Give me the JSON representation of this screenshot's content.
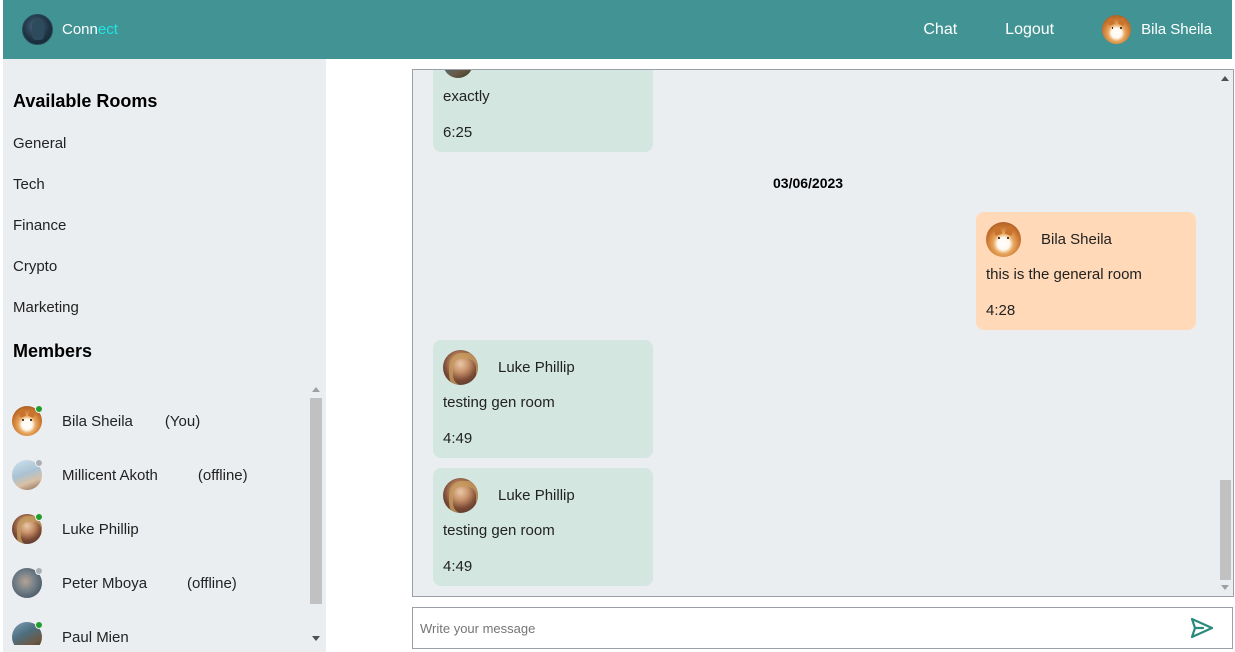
{
  "navbar": {
    "brand_prefix": "Conn",
    "brand_accent": "ect",
    "chat_label": "Chat",
    "logout_label": "Logout",
    "user_name": "Bila Sheila",
    "colors": {
      "background": "#429494",
      "accent": "#20e3e3"
    }
  },
  "sidebar": {
    "rooms_title": "Available Rooms",
    "rooms": [
      {
        "label": "General"
      },
      {
        "label": "Tech"
      },
      {
        "label": "Finance"
      },
      {
        "label": "Crypto"
      },
      {
        "label": "Marketing"
      }
    ],
    "members_title": "Members",
    "members": [
      {
        "name": "Bila Sheila",
        "tag": "(You)",
        "status": "online",
        "avatar": "shiba-avatar"
      },
      {
        "name": "Millicent Akoth",
        "tag": "(offline)",
        "status": "offline",
        "avatar": "beach-avatar"
      },
      {
        "name": "Luke Phillip",
        "tag": "",
        "status": "online",
        "avatar": "woman-avatar"
      },
      {
        "name": "Peter Mboya",
        "tag": "(offline)",
        "status": "offline",
        "avatar": "man-avatar"
      },
      {
        "name": "Paul Mien",
        "tag": "",
        "status": "online",
        "avatar": "hiker-avatar"
      }
    ]
  },
  "chat": {
    "messages": [
      {
        "id": "m0",
        "sender": "",
        "text": "exactly",
        "time": "6:25",
        "side": "received"
      },
      {
        "id": "m1",
        "sender": "Bila Sheila",
        "text": "this is the general room",
        "time": "4:28",
        "side": "sent"
      },
      {
        "id": "m2",
        "sender": "Luke Phillip",
        "text": "testing gen room",
        "time": "4:49",
        "side": "received"
      },
      {
        "id": "m3",
        "sender": "Luke Phillip",
        "text": "testing gen room",
        "time": "4:49",
        "side": "received"
      }
    ],
    "date_separator": "03/06/2023",
    "colors": {
      "received": "#d3e6df",
      "sent": "#ffd9b8",
      "online": "#1f9e2d"
    }
  },
  "composer": {
    "placeholder": "Write your message",
    "value": "",
    "send_icon": "send-icon",
    "send_color": "#2a8a7c"
  }
}
